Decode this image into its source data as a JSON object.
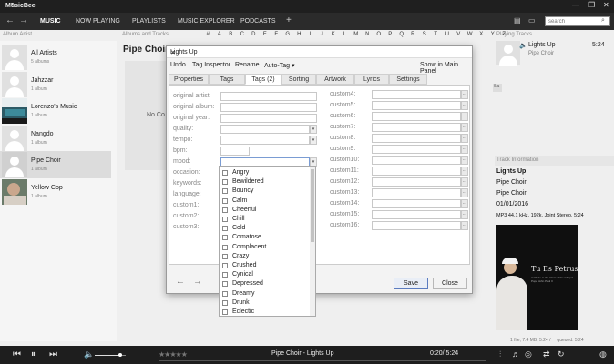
{
  "app": {
    "title": "MusicBee"
  },
  "nav": {
    "tabs": [
      "MUSIC",
      "NOW PLAYING",
      "PLAYLISTS",
      "MUSIC EXPLORER",
      "PODCASTS"
    ],
    "add_tab": "+",
    "search_placeholder": "search"
  },
  "columns": {
    "album_artist": "Album Artist",
    "albums_tracks": "Albums and Tracks",
    "playing_tracks": "Playing Tracks"
  },
  "alphabet": [
    "#",
    "A",
    "B",
    "C",
    "D",
    "E",
    "F",
    "G",
    "H",
    "I",
    "J",
    "K",
    "L",
    "M",
    "N",
    "O",
    "P",
    "Q",
    "R",
    "S",
    "T",
    "U",
    "V",
    "W",
    "X",
    "Y",
    "Z"
  ],
  "artists": [
    {
      "name": "All Artists",
      "count": "5 albums"
    },
    {
      "name": "Jahzzar",
      "count": "1 album"
    },
    {
      "name": "Lorenzo's Music",
      "count": "1 album"
    },
    {
      "name": "Nangdo",
      "count": "1 album"
    },
    {
      "name": "Pipe Choir",
      "count": "1 album"
    },
    {
      "name": "Yellow Cop",
      "count": "1 album"
    }
  ],
  "center": {
    "album_title": "Pipe Choir",
    "no_cover": "No Co"
  },
  "now_playing": {
    "title": "Lights Up",
    "time": "5:24",
    "artist": "Pipe Choir",
    "stub": "Sa"
  },
  "track_info": {
    "header": "Track Information",
    "title": "Lights Up",
    "artist": "Pipe Choir",
    "album_artist": "Pipe Choir",
    "date": "01/01/2016",
    "format": "MP3 44.1 kHz, 192k, Joint Stereo, 5:24"
  },
  "cover": {
    "title": "Tu Es Petrus",
    "subtitle": "A tribute to the Choir of the Chapel Pope John Paul II"
  },
  "status": {
    "text": "1 file, 7.4 MB, 5:24 /",
    "queued": "queued: 5:24"
  },
  "player": {
    "track": "Pipe Choir - Lights Up",
    "time": "0:20/ 5:24",
    "stars": "★★★★★",
    "rating": 0
  },
  "dialog": {
    "title": "Lights Up",
    "menu": [
      "Undo",
      "Tag Inspector",
      "Rename",
      "Auto-Tag ▾",
      "Show in Main Panel"
    ],
    "tabs": [
      "Properties",
      "Tags",
      "Tags (2)",
      "Sorting",
      "Artwork",
      "Lyrics",
      "Settings"
    ],
    "left_fields": [
      "original artist:",
      "original album:",
      "original year:",
      "quality:",
      "tempo:",
      "bpm:",
      "mood:",
      "occasion:",
      "keywords:",
      "language:",
      "custom1:",
      "custom2:",
      "custom3:"
    ],
    "right_fields": [
      "custom4:",
      "custom5:",
      "custom6:",
      "custom7:",
      "custom8:",
      "custom9:",
      "custom10:",
      "custom11:",
      "custom12:",
      "custom13:",
      "custom14:",
      "custom15:",
      "custom16:"
    ],
    "ellipsis": "...",
    "dropdown_glyph": "▾",
    "save": "Save",
    "close": "Close"
  },
  "moods": [
    "Angry",
    "Bewildered",
    "Bouncy",
    "Calm",
    "Cheerful",
    "Chill",
    "Cold",
    "Comatose",
    "Complacent",
    "Crazy",
    "Crushed",
    "Cynical",
    "Depressed",
    "Dreamy",
    "Drunk",
    "Eclectic"
  ],
  "icons": {
    "back": "back-arrow-icon",
    "forward": "forward-arrow-icon",
    "minimize": "minimize-icon",
    "maximize": "maximize-icon",
    "close": "close-icon",
    "search": "search-icon",
    "speaker": "speaker-icon",
    "prev": "prev-track-icon",
    "pause": "pause-icon",
    "next": "next-track-icon",
    "volume": "volume-icon"
  }
}
